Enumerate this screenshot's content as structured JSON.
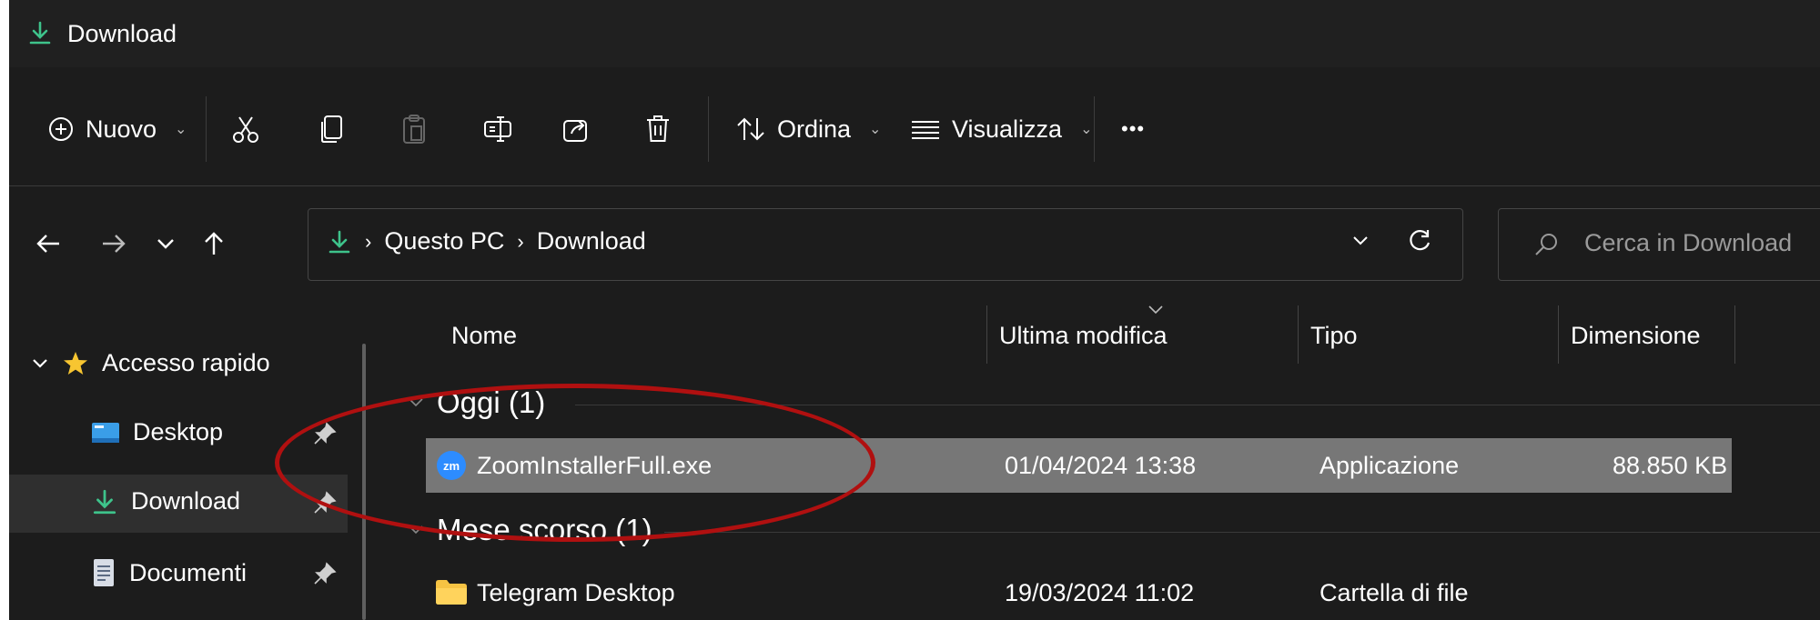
{
  "window": {
    "title": "Download"
  },
  "toolbar": {
    "new_label": "Nuovo",
    "sort_label": "Ordina",
    "view_label": "Visualizza",
    "more_label": "•••"
  },
  "address": {
    "crumbs": [
      "Questo PC",
      "Download"
    ],
    "search_placeholder": "Cerca in Download"
  },
  "sidebar": {
    "items": [
      {
        "label": "Accesso rapido",
        "icon": "star-icon"
      },
      {
        "label": "Desktop",
        "icon": "desktop-folder-icon"
      },
      {
        "label": "Download",
        "icon": "download-icon"
      },
      {
        "label": "Documenti",
        "icon": "document-icon"
      }
    ]
  },
  "columns": [
    "Nome",
    "Ultima modifica",
    "Tipo",
    "Dimensione"
  ],
  "groups": [
    {
      "label": "Oggi (1)",
      "rows": [
        {
          "name": "ZoomInstallerFull.exe",
          "modified": "01/04/2024 13:38",
          "type": "Applicazione",
          "size": "88.850 KB"
        }
      ]
    },
    {
      "label": "Mese scorso (1)",
      "rows": [
        {
          "name": "Telegram Desktop",
          "modified": "19/03/2024 11:02",
          "type": "Cartella di file",
          "size": ""
        }
      ]
    }
  ],
  "zoom_icon_text": "zm",
  "colors": {
    "accent": "#3ec38b",
    "selection": "#777777",
    "annotation": "#b01010"
  }
}
